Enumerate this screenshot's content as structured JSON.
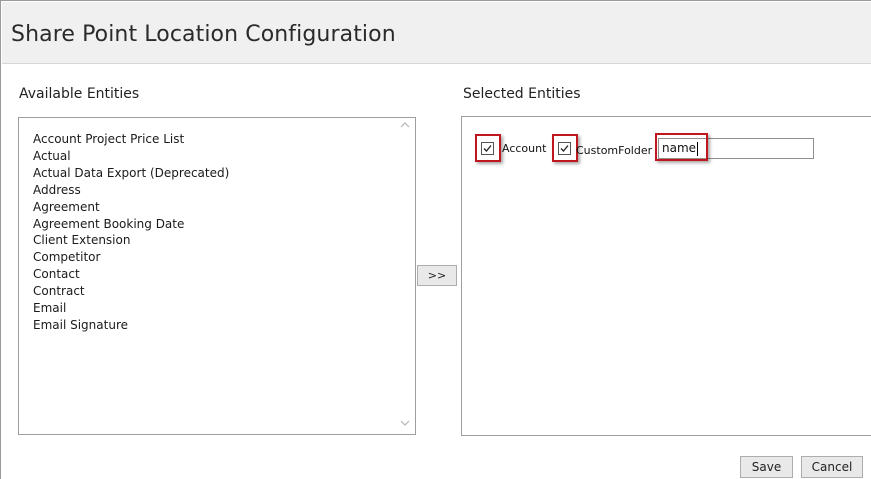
{
  "dialog": {
    "title": "Share Point Location Configuration"
  },
  "available": {
    "label": "Available Entities",
    "items": [
      "Account Project Price List",
      "Actual",
      "Actual Data Export (Deprecated)",
      "Address",
      "Agreement",
      "Agreement Booking Date",
      "Client Extension",
      "Competitor",
      "Contact",
      "Contract",
      "Email",
      "Email Signature"
    ]
  },
  "move_button": {
    "label": ">>"
  },
  "selected": {
    "label": "Selected Entities",
    "account_checkbox": {
      "label": "Account",
      "checked": true
    },
    "customfolder_checkbox": {
      "label": "CustomFolder",
      "checked": true
    },
    "folder_name_input": {
      "value": "name"
    }
  },
  "footer": {
    "save_label": "Save",
    "cancel_label": "Cancel"
  },
  "colors": {
    "highlight": "#c0161f",
    "title_bar": "#f0f0f0"
  },
  "icons": {
    "scroll_up": "chevron-up-icon",
    "scroll_down": "chevron-down-icon",
    "checkmark": "checkmark-icon"
  }
}
